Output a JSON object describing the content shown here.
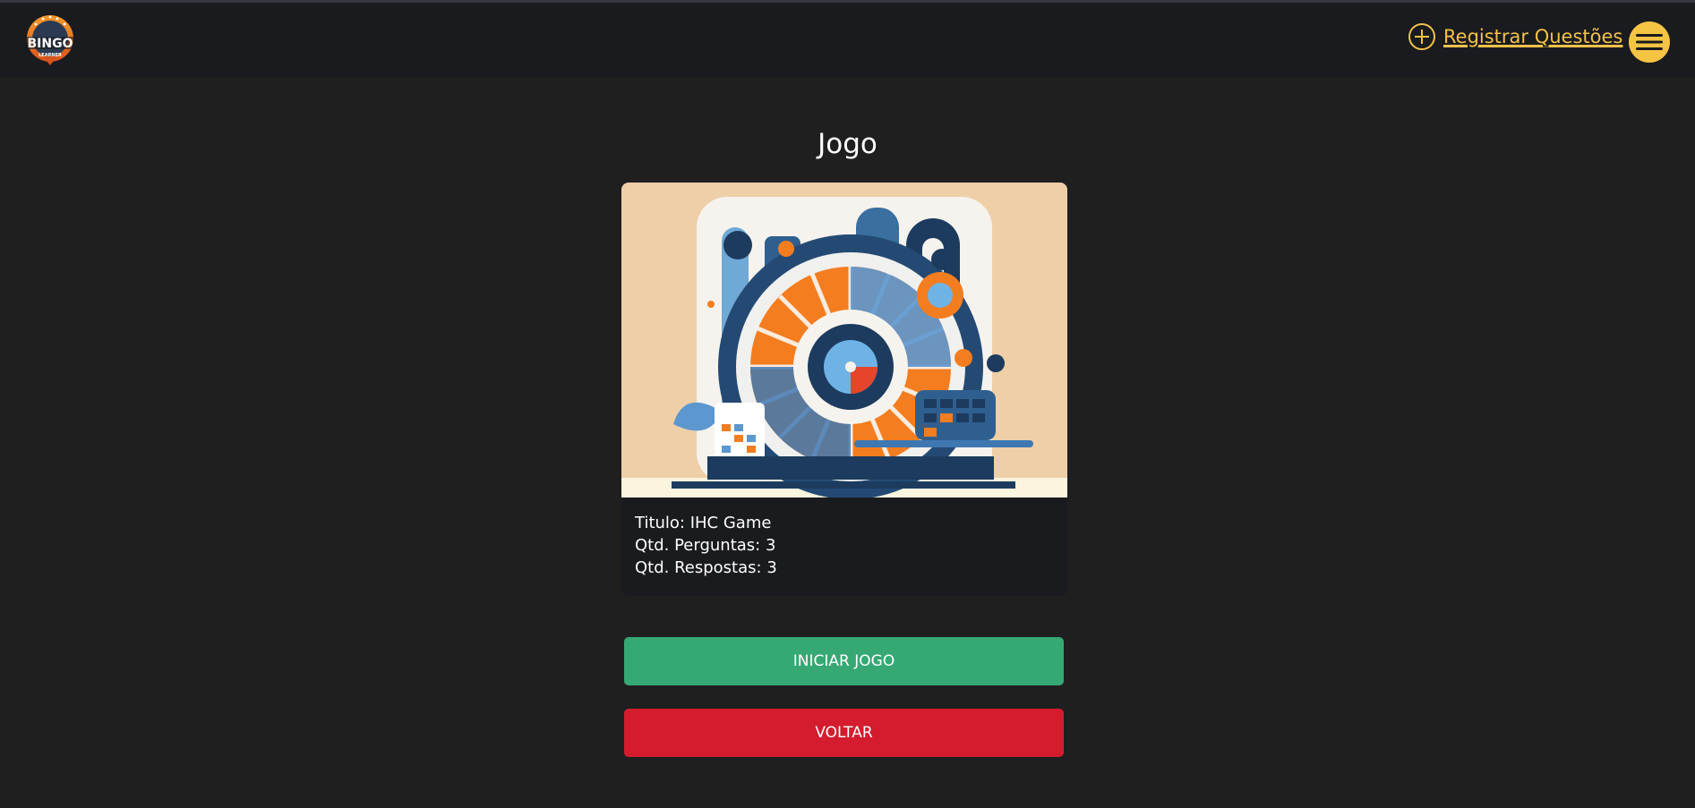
{
  "logo": {
    "text_top": "BINGO",
    "text_bottom": "LEARNER"
  },
  "header": {
    "register_label": "Registrar Questões",
    "icons": {
      "register": "plus-circle-icon",
      "menu": "hamburger-menu-icon"
    }
  },
  "page": {
    "title": "Jogo"
  },
  "game": {
    "title_line": "Titulo: IHC Game",
    "questions_line": "Qtd. Perguntas: 3",
    "answers_line": "Qtd. Respostas: 3"
  },
  "buttons": {
    "start_label": "INICIAR JOGO",
    "back_label": "VOLTAR"
  },
  "colors": {
    "background": "#1f1f20",
    "header": "#1a1b1e",
    "accent_yellow": "#f3c14a",
    "start_green": "#36a874",
    "back_red": "#d41c2e"
  }
}
